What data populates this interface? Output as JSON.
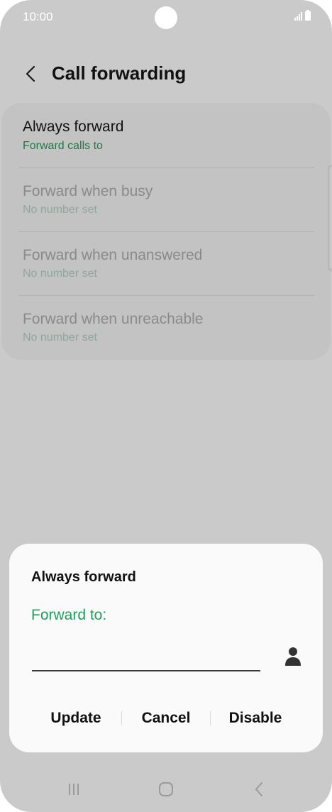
{
  "status_bar": {
    "time": "10:00",
    "icons": [
      "signal-icon",
      "battery-icon"
    ]
  },
  "header": {
    "title": "Call forwarding",
    "back_icon": "chevron-left-icon"
  },
  "settings": {
    "items": [
      {
        "title": "Always forward",
        "subtitle": "Forward calls to"
      },
      {
        "title": "Forward when busy",
        "subtitle": "No number set"
      },
      {
        "title": "Forward when unanswered",
        "subtitle": "No number set"
      },
      {
        "title": "Forward when unreachable",
        "subtitle": "No number set"
      }
    ]
  },
  "dialog": {
    "title": "Always forward",
    "field_label": "Forward to:",
    "input_value": "",
    "input_placeholder": "",
    "contact_icon": "person-icon",
    "actions": {
      "update": "Update",
      "cancel": "Cancel",
      "disable": "Disable"
    }
  },
  "nav_bar": {
    "icons": [
      "recents-icon",
      "home-icon",
      "back-icon"
    ]
  },
  "colors": {
    "accent_green": "#1fa05c",
    "subtitle_green": "#1d7a45",
    "scrim": "#cacaca",
    "dialog_bg": "#fafafa"
  }
}
